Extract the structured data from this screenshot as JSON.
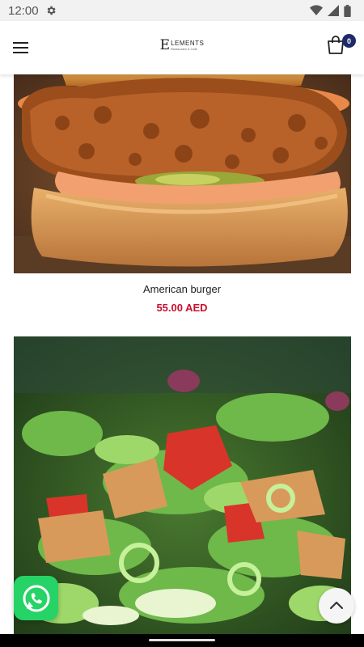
{
  "status_bar": {
    "time": "12:00",
    "icons": [
      "gear-icon",
      "wifi-icon",
      "signal-icon",
      "battery-icon"
    ]
  },
  "header": {
    "menu_icon": "hamburger-menu-icon",
    "logo": {
      "mark": "E",
      "title": "LEMENTS",
      "subtitle": "Restaurant & Cafe"
    },
    "cart_icon": "shopping-bag-icon",
    "cart_count": "0"
  },
  "products": [
    {
      "name": "American burger",
      "price": "55.00 AED",
      "image": "burger-photo"
    },
    {
      "name": "",
      "price": "",
      "image": "fattoush-salad-photo"
    }
  ],
  "floating": {
    "whatsapp_icon": "whatsapp-icon",
    "scroll_top_icon": "chevron-up-icon"
  },
  "colors": {
    "price": "#c8102e",
    "badge": "#1f2a6b",
    "whatsapp": "#25d366"
  }
}
